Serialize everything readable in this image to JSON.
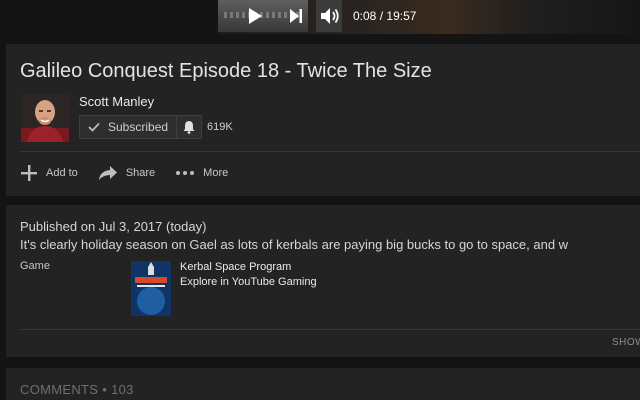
{
  "player": {
    "time_current": "0:08",
    "time_separator": "/",
    "time_total": "19:57"
  },
  "video": {
    "title": "Galileo Conquest Episode 18 - Twice The Size"
  },
  "owner": {
    "name": "Scott Manley",
    "subscribe_label": "Subscribed",
    "subscriber_count": "619K"
  },
  "actions": [
    {
      "label": "Add to",
      "icon": "add-icon"
    },
    {
      "label": "Share",
      "icon": "share-icon"
    },
    {
      "label": "More",
      "icon": "more-icon"
    }
  ],
  "description": {
    "published": "Published on Jul 3, 2017 (today)",
    "text": "It's clearly holiday season on Gael as lots of kerbals are paying big bucks to go to space, and w",
    "meta_key": "Game",
    "game_title": "Kerbal Space Program",
    "game_link": "Explore in YouTube Gaming",
    "show_more": "SHOW"
  },
  "comments": {
    "label": "COMMENTS",
    "separator": "•",
    "count": "103"
  },
  "colors": {
    "background": "#141414",
    "card": "#232323",
    "divider": "#363636"
  }
}
